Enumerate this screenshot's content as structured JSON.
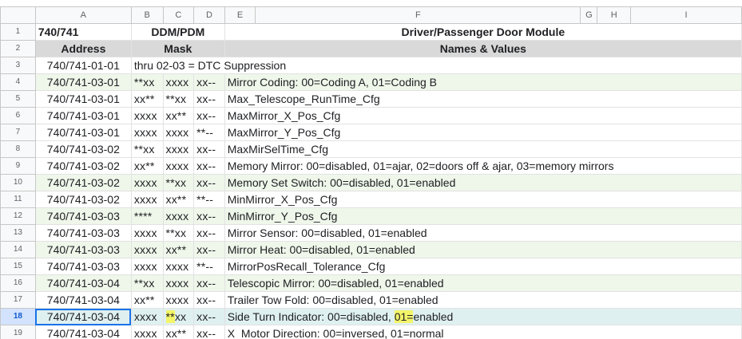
{
  "columns": [
    "A",
    "B",
    "C",
    "D",
    "E",
    "F",
    "G",
    "H",
    "I"
  ],
  "header_row1": {
    "rownum": "1",
    "a": "740/741",
    "bcd": "DDM/PDM",
    "title": "Driver/Passenger Door Module"
  },
  "header_row2": {
    "rownum": "2",
    "a": "Address",
    "bcd": "Mask",
    "title": "Names & Values"
  },
  "row3": {
    "rownum": "3",
    "a": "740/741-01-01",
    "text": "thru 02-03 = DTC Suppression"
  },
  "rows": [
    {
      "rownum": "4",
      "addr": "740/741-03-01",
      "b": "**xx",
      "c": "xxxx",
      "d": "xx--",
      "name": "Mirror Coding:",
      "value": " 00=Coding A, 01=Coding B"
    },
    {
      "rownum": "5",
      "addr": "740/741-03-01",
      "b": "xx**",
      "c": "**xx",
      "d": "xx--",
      "name": "Max_Telescope_RunTime_Cfg",
      "value": ""
    },
    {
      "rownum": "6",
      "addr": "740/741-03-01",
      "b": "xxxx",
      "c": "xx**",
      "d": "xx--",
      "name": "MaxMirror_X_Pos_Cfg",
      "value": ""
    },
    {
      "rownum": "7",
      "addr": "740/741-03-01",
      "b": "xxxx",
      "c": "xxxx",
      "d": "**--",
      "name": "MaxMirror_Y_Pos_Cfg",
      "value": ""
    },
    {
      "rownum": "8",
      "addr": "740/741-03-02",
      "b": "**xx",
      "c": "xxxx",
      "d": "xx--",
      "name": "MaxMirSelTime_Cfg",
      "value": ""
    },
    {
      "rownum": "9",
      "addr": "740/741-03-02",
      "b": "xx**",
      "c": "xxxx",
      "d": "xx--",
      "name": "Memory Mirror:",
      "value": " 00=disabled, 01=ajar, 02=doors off & ajar, 03=memory mirrors"
    },
    {
      "rownum": "10",
      "addr": "740/741-03-02",
      "b": "xxxx",
      "c": "**xx",
      "d": "xx--",
      "name": "Memory Set Switch:",
      "value": " 00=disabled, 01=enabled"
    },
    {
      "rownum": "11",
      "addr": "740/741-03-02",
      "b": "xxxx",
      "c": "xx**",
      "d": "**--",
      "name": "MinMirror_X_Pos_Cfg",
      "value": ""
    },
    {
      "rownum": "12",
      "addr": "740/741-03-03",
      "b": "****",
      "c": "xxxx",
      "d": "xx--",
      "name": "MinMirror_Y_Pos_Cfg",
      "value": ""
    },
    {
      "rownum": "13",
      "addr": "740/741-03-03",
      "b": "xxxx",
      "c": "**xx",
      "d": "xx--",
      "name": "Mirror Sensor:",
      "value": " 00=disabled, 01=enabled"
    },
    {
      "rownum": "14",
      "addr": "740/741-03-03",
      "b": "xxxx",
      "c": "xx**",
      "d": "xx--",
      "name": "Mirror Heat:",
      "value": " 00=disabled, 01=enabled"
    },
    {
      "rownum": "15",
      "addr": "740/741-03-03",
      "b": "xxxx",
      "c": "xxxx",
      "d": "**--",
      "name": "MirrorPosRecall_Tolerance_Cfg",
      "value": ""
    },
    {
      "rownum": "16",
      "addr": "740/741-03-04",
      "b": "**xx",
      "c": "xxxx",
      "d": "xx--",
      "name": "Telescopic Mirror:",
      "value": " 00=disabled, 01=enabled"
    },
    {
      "rownum": "17",
      "addr": "740/741-03-04",
      "b": "xx**",
      "c": "xxxx",
      "d": "xx--",
      "name": "Trailer Tow Fold:",
      "value": " 00=disabled, 01=enabled"
    },
    {
      "rownum": "18",
      "addr": "740/741-03-04",
      "b": "xxxx",
      "c_hl": "**",
      "c_rest": "xx",
      "d": "xx--",
      "name": "Side Turn Indicator:",
      "value_a": " 00=disabled, ",
      "value_hl": "01=",
      "value_b": "enabled"
    },
    {
      "rownum": "19",
      "addr": "740/741-03-04",
      "b": "xxxx",
      "c": "xx**",
      "d": "xx--",
      "name": "X_Motor Direction:",
      "value": " 00=inversed, 01=normal"
    }
  ],
  "colors": {
    "header_gray": "#d9d9d9",
    "row_green": "#eef7ea",
    "selected_row": "#dff0f0",
    "highlight": "#f4f469",
    "select_blue": "#1a73e8"
  }
}
